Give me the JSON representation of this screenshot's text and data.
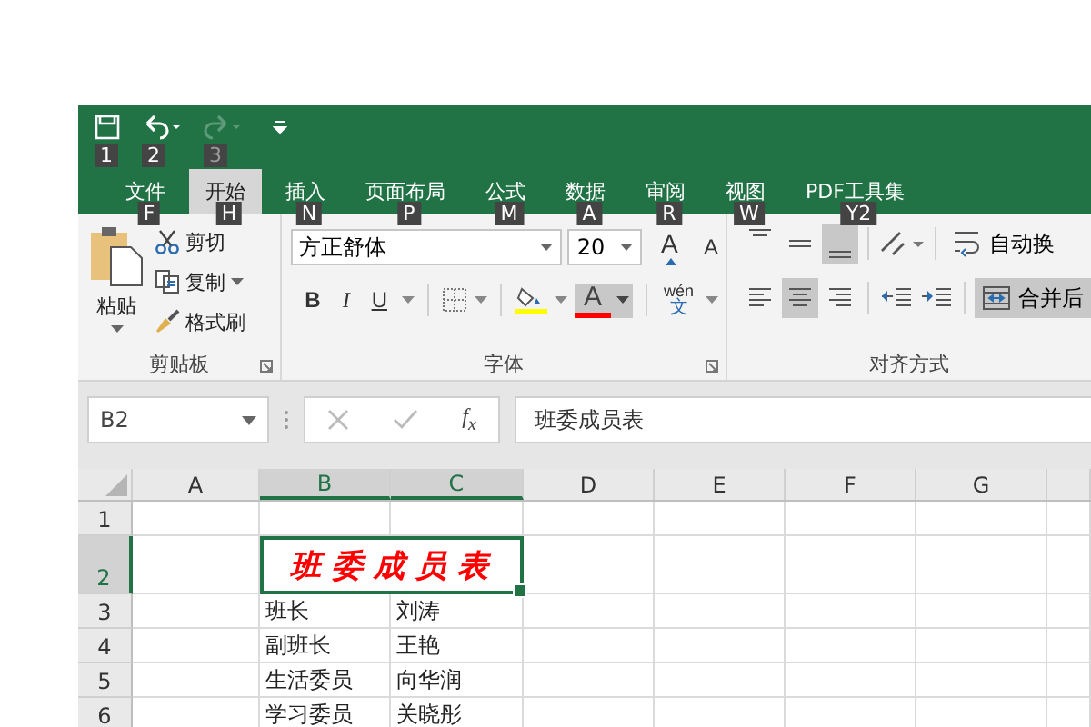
{
  "quick_access": [
    {
      "kind": "save",
      "keytip": "1",
      "disabled": false
    },
    {
      "kind": "undo",
      "keytip": "2",
      "disabled": false
    },
    {
      "kind": "redo",
      "keytip": "3",
      "disabled": true
    },
    {
      "kind": "customize"
    }
  ],
  "tabs": [
    {
      "label": "文件",
      "keytip": "F",
      "selected": false
    },
    {
      "label": "开始",
      "keytip": "H",
      "selected": true
    },
    {
      "label": "插入",
      "keytip": "N",
      "selected": false
    },
    {
      "label": "页面布局",
      "keytip": "P",
      "selected": false
    },
    {
      "label": "公式",
      "keytip": "M",
      "selected": false
    },
    {
      "label": "数据",
      "keytip": "A",
      "selected": false
    },
    {
      "label": "审阅",
      "keytip": "R",
      "selected": false
    },
    {
      "label": "视图",
      "keytip": "W",
      "selected": false
    },
    {
      "label": "PDF工具集",
      "keytip": "Y2",
      "selected": false
    }
  ],
  "clipboard": {
    "paste": "粘贴",
    "cut": "剪切",
    "copy": "复制",
    "format_painter": "格式刷",
    "label": "剪贴板"
  },
  "font": {
    "font_name": "方正舒体",
    "font_size": "20",
    "grow": "A",
    "shrink": "A",
    "bold": "B",
    "italic": "I",
    "underline": "U",
    "font_color": "A",
    "font_color_pressed": true,
    "phonetic": "wén",
    "phonetic_char": "文",
    "label": "字体"
  },
  "alignment": {
    "row1": [
      {
        "kind": "top",
        "pressed": false
      },
      {
        "kind": "middle",
        "pressed": false
      },
      {
        "kind": "bottom",
        "pressed": true
      },
      {
        "kind": "orientation",
        "pressed": false
      }
    ],
    "row2": [
      {
        "kind": "left",
        "pressed": false
      },
      {
        "kind": "center",
        "pressed": true
      },
      {
        "kind": "right",
        "pressed": false
      },
      {
        "kind": "outdent",
        "pressed": false
      },
      {
        "kind": "indent",
        "pressed": false
      }
    ],
    "wrap_text": "自动换",
    "wrap_pressed": false,
    "merge": "合并后",
    "merge_pressed": true,
    "label": "对齐方式"
  },
  "formula_bar": {
    "name_box": "B2",
    "fx": "f$_{x}$",
    "formula": "班委成员表"
  },
  "sheet": {
    "columns": [
      {
        "label": "A",
        "selected": false
      },
      {
        "label": "B",
        "selected": true
      },
      {
        "label": "C",
        "selected": true
      },
      {
        "label": "D",
        "selected": false
      },
      {
        "label": "E",
        "selected": false
      },
      {
        "label": "F",
        "selected": false
      },
      {
        "label": "G",
        "selected": false
      }
    ],
    "rows": [
      {
        "label": "1",
        "selected": false
      },
      {
        "label": "2",
        "selected": true,
        "title": "班委成员表"
      },
      {
        "label": "3",
        "selected": false,
        "b": "班长",
        "c": "刘涛"
      },
      {
        "label": "4",
        "selected": false,
        "b": "副班长",
        "c": "王艳"
      },
      {
        "label": "5",
        "selected": false,
        "b": "生活委员",
        "c": "向华润"
      },
      {
        "label": "6",
        "selected": false,
        "b": "学习委员",
        "c": "关晓彤"
      }
    ]
  }
}
